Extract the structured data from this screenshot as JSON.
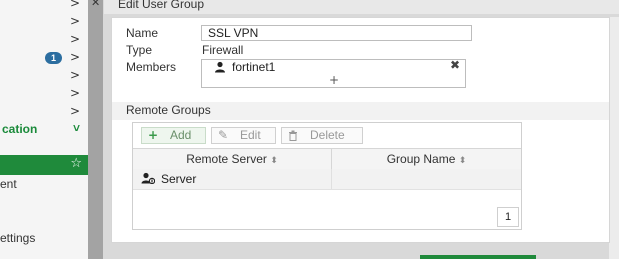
{
  "dialog": {
    "title": "Edit User Group"
  },
  "sidebar": {
    "chevron": ">",
    "badge": "1",
    "section_label": "cation",
    "section_chevron": "˅",
    "star_icon": "☆",
    "items_text": [
      "ent",
      "ettings"
    ]
  },
  "gutter": {
    "close": "✕"
  },
  "form": {
    "name_label": "Name",
    "name_value": "SSL VPN",
    "type_label": "Type",
    "type_value": "Firewall",
    "members_label": "Members",
    "members": [
      {
        "name": "fortinet1"
      }
    ],
    "add_member": "+",
    "remove_member": "✖"
  },
  "remote_groups": {
    "header": "Remote Groups",
    "toolbar": {
      "add_icon": "+",
      "add_label": "Add",
      "edit_icon": "✎",
      "edit_label": "Edit",
      "delete_icon": "🗑",
      "delete_label": "Delete"
    },
    "columns": [
      "Remote Server",
      "Group Name"
    ],
    "sort_icon": "⬍",
    "rows": [
      {
        "server": "Server",
        "group": ""
      }
    ],
    "page": "1"
  },
  "colors": {
    "accent_green": "#1f8a3b",
    "badge_blue": "#2c6ea0"
  }
}
